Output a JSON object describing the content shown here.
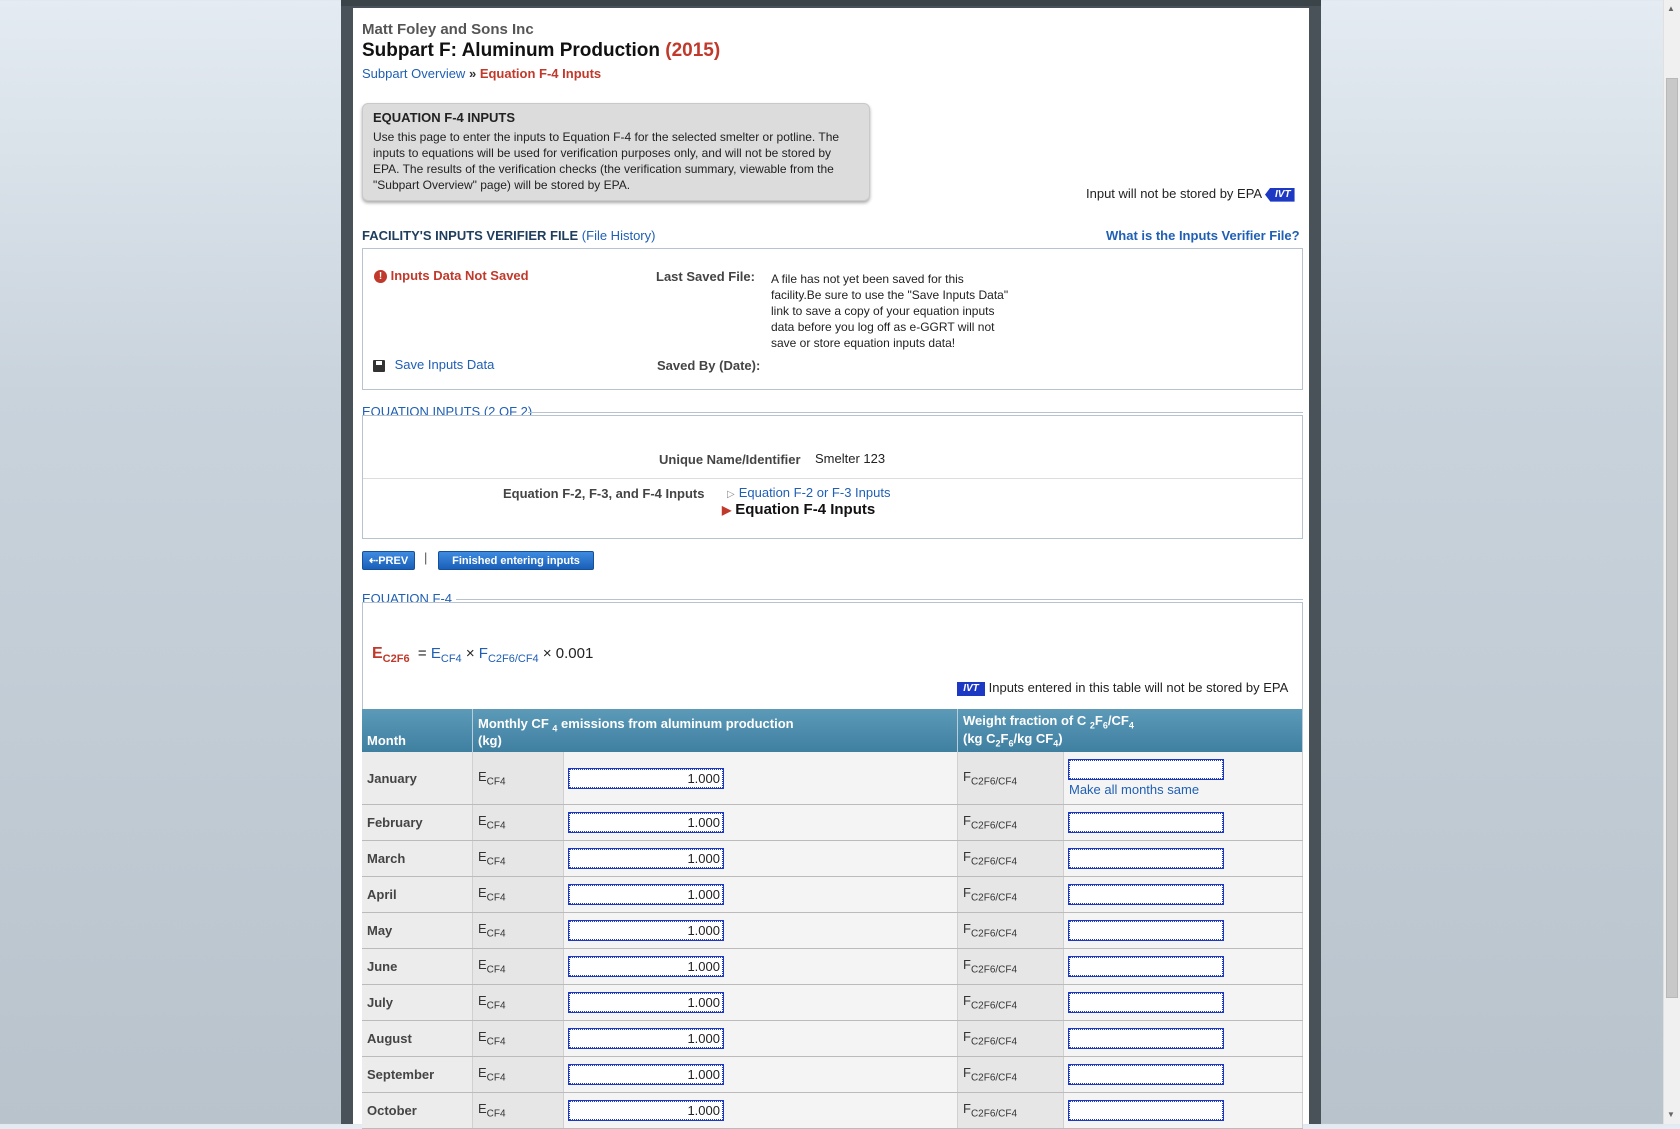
{
  "header": {
    "company": "Matt Foley and Sons Inc",
    "title": "Subpart F: Aluminum Production",
    "year": "(2015)"
  },
  "breadcrumb": {
    "overview": "Subpart Overview",
    "separator": "»",
    "current": "Equation F-4 Inputs"
  },
  "infobox": {
    "heading": "EQUATION F-4 INPUTS",
    "text": "Use this page to enter the inputs to Equation F-4 for the selected smelter or potline. The inputs to equations will be used for verification purposes only, and will not be stored by EPA. The results of the verification checks (the verification summary, viewable from the \"Subpart Overview\" page) will be stored by EPA."
  },
  "ivt": {
    "badge": "IVT",
    "top_note": "Input will not be stored by EPA",
    "table_note": "Inputs entered in this table will not be stored by EPA"
  },
  "verifier_file": {
    "section_title": "FACILITY'S INPUTS VERIFIER FILE",
    "history_link": "(File History)",
    "whatis_link": "What is the Inputs Verifier File?",
    "status": "Inputs Data Not Saved",
    "last_saved_label": "Last Saved File:",
    "last_saved_value": "A file has not yet been saved for this facility.Be sure to use the \"Save Inputs Data\" link to save a copy of your equation inputs data before you log off as e-GGRT will not save or store equation inputs data!",
    "save_link": "Save Inputs Data",
    "saved_by_label": "Saved By (Date):"
  },
  "equation_inputs": {
    "section_title": "EQUATION INPUTS (2 OF 2)",
    "unique_name_label": "Unique Name/Identifier",
    "unique_name_value": "Smelter 123",
    "inputs_label": "Equation F-2, F-3, and F-4 Inputs",
    "link_f2f3": "Equation F-2 or F-3 Inputs",
    "link_f4": "Equation F-4 Inputs"
  },
  "buttons": {
    "prev": "PREV",
    "separator": "|",
    "finish": "Finished entering inputs"
  },
  "equation": {
    "section_title": "EQUATION F-4",
    "lhs": "E",
    "lhs_sub": "C2F6",
    "eq": "=",
    "v1": "E",
    "v1_sub": "CF4",
    "times1": "×",
    "v2": "F",
    "v2_sub": "C2F6/CF4",
    "tail": "× 0.001"
  },
  "table": {
    "col_month": "Month",
    "col_emissions_a": "Monthly CF",
    "col_emissions_sub": "4",
    "col_emissions_b": "emissions from aluminum production",
    "col_emissions_unit": "(kg)",
    "col_fraction_a": "Weight fraction of C",
    "col_fraction_sub1": "2",
    "col_fraction_b": "F",
    "col_fraction_sub2": "6",
    "col_fraction_c": "/CF",
    "col_fraction_sub3": "4",
    "col_fraction_unit_a": "(kg C",
    "col_fraction_unit_sub1": "2",
    "col_fraction_unit_b": "F",
    "col_fraction_unit_sub2": "6",
    "col_fraction_unit_c": "/kg CF",
    "col_fraction_unit_sub3": "4",
    "col_fraction_unit_d": ")",
    "var_e": "E",
    "var_e_sub": "CF4",
    "var_f": "F",
    "var_f_sub": "C2F6/CF4",
    "make_same": "Make all months same",
    "rows": [
      {
        "month": "January",
        "value": "1.000",
        "fraction": ""
      },
      {
        "month": "February",
        "value": "1.000",
        "fraction": ""
      },
      {
        "month": "March",
        "value": "1.000",
        "fraction": ""
      },
      {
        "month": "April",
        "value": "1.000",
        "fraction": ""
      },
      {
        "month": "May",
        "value": "1.000",
        "fraction": ""
      },
      {
        "month": "June",
        "value": "1.000",
        "fraction": ""
      },
      {
        "month": "July",
        "value": "1.000",
        "fraction": ""
      },
      {
        "month": "August",
        "value": "1.000",
        "fraction": ""
      },
      {
        "month": "September",
        "value": "1.000",
        "fraction": ""
      },
      {
        "month": "October",
        "value": "1.000",
        "fraction": ""
      }
    ]
  },
  "colors": {
    "accent_red": "#c0392b",
    "link_blue": "#1f5fb4",
    "ivt_blue": "#1d39c4",
    "table_header": "#4a8aab"
  }
}
